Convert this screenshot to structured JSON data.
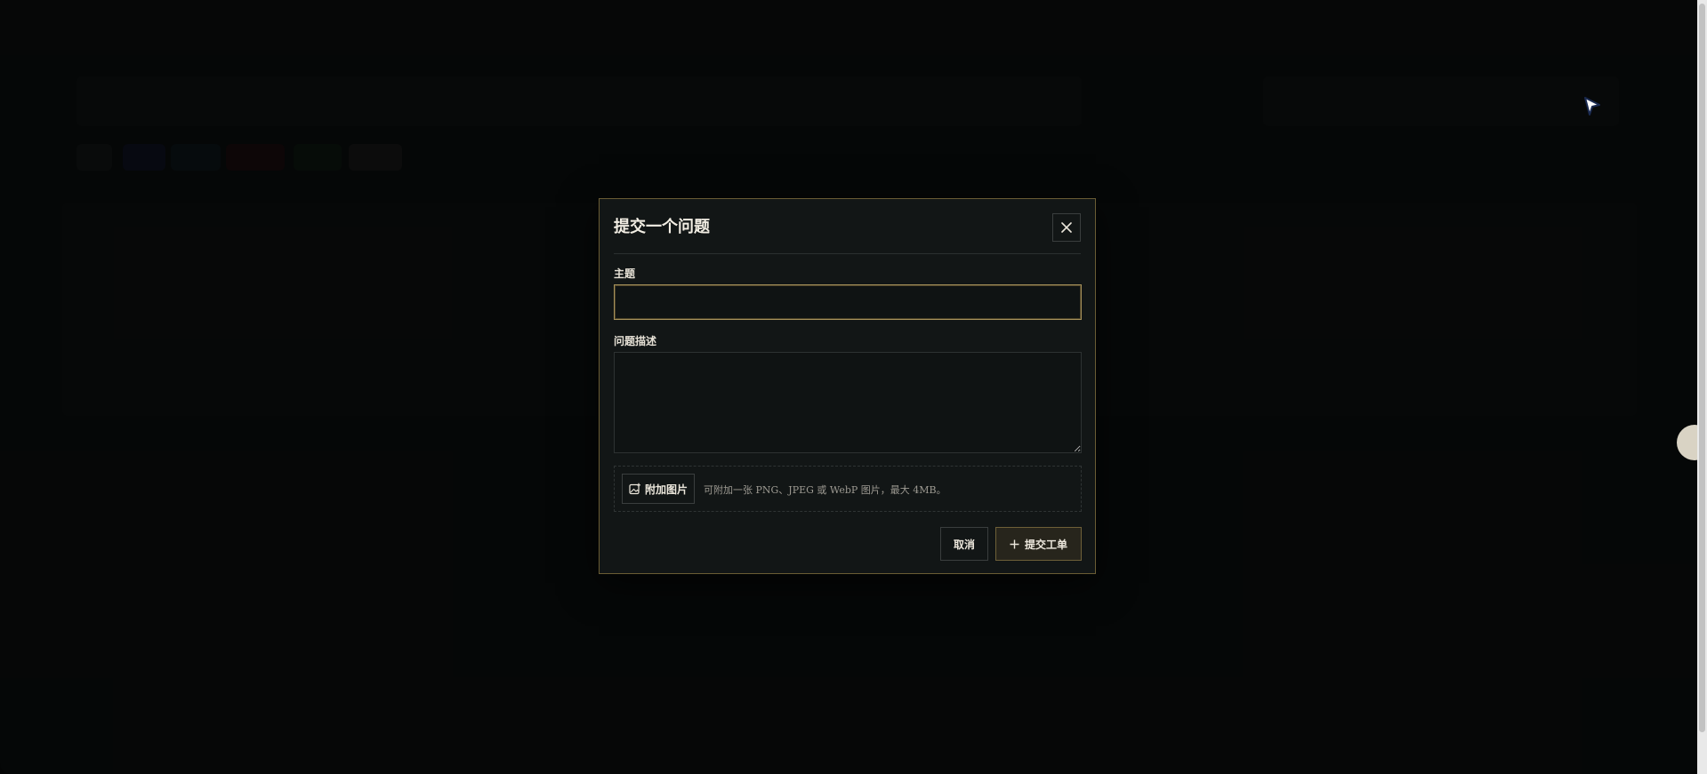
{
  "modal": {
    "title": "提交一个问题",
    "subject_label": "主题",
    "subject_value": "",
    "description_label": "问题描述",
    "description_value": "",
    "attach_label": "附加图片",
    "attach_hint": "可附加一张 PNG、JPEG 或 WebP 图片，最大 4MB。",
    "cancel_label": "取消",
    "submit_label": "提交工单"
  },
  "colors": {
    "accent_border": "#a5905a",
    "modal_background": "#121616",
    "overlay": "#000000"
  },
  "icons": {
    "close": "close-icon",
    "attach": "image-plus-icon",
    "submit": "plus-icon",
    "cursor": "cursor-icon"
  }
}
